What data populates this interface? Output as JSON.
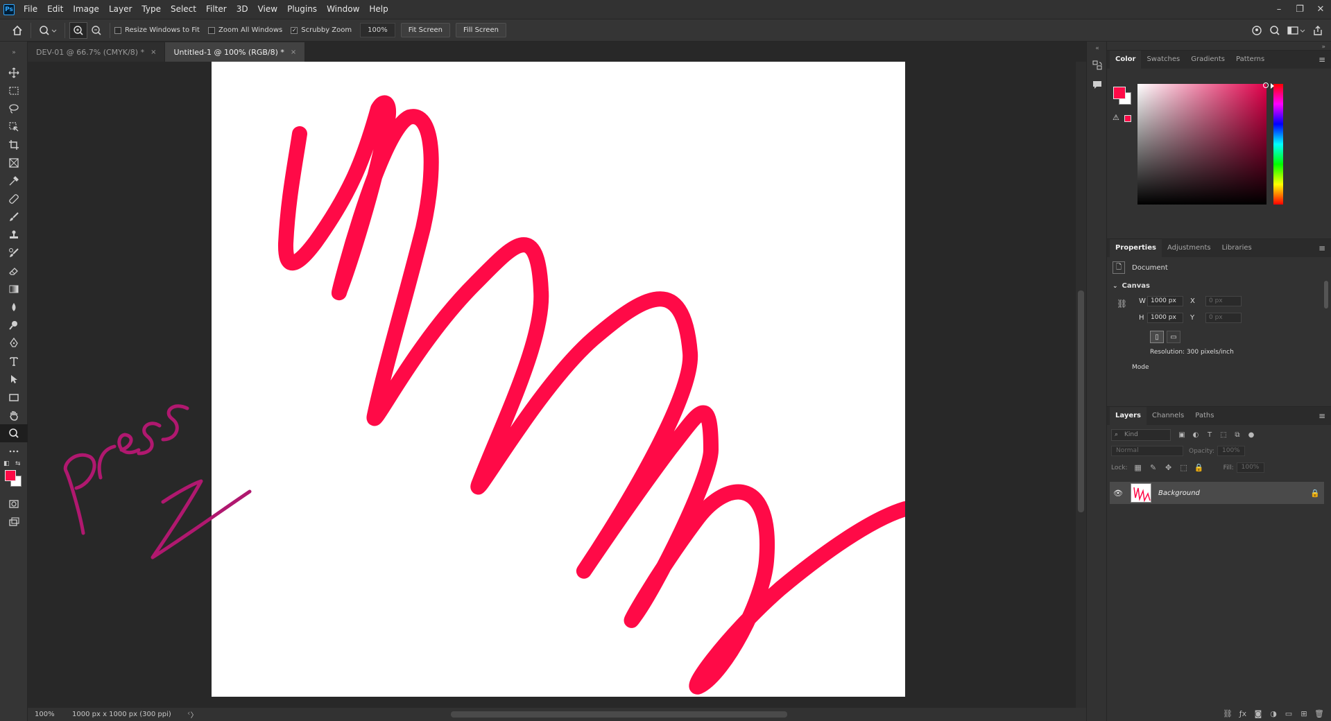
{
  "menu": [
    "File",
    "Edit",
    "Image",
    "Layer",
    "Type",
    "Select",
    "Filter",
    "3D",
    "View",
    "Plugins",
    "Window",
    "Help"
  ],
  "app_logo": "Ps",
  "window_controls": {
    "minimize": "–",
    "restore": "❐",
    "close": "✕"
  },
  "options": {
    "resize_windows": "Resize Windows to Fit",
    "zoom_all": "Zoom All Windows",
    "scrubby_zoom": "Scrubby Zoom",
    "scrubby_check": "✓",
    "zoom_value": "100%",
    "fit_screen": "Fit Screen",
    "fill_screen": "Fill Screen"
  },
  "tabs": [
    {
      "title": "DEV-01 @ 66.7% (CMYK/8) *",
      "close": "×"
    },
    {
      "title": "Untitled-1 @ 100% (RGB/8) *",
      "close": "×"
    }
  ],
  "status": {
    "zoom": "100%",
    "doc_info": "1000 px x 1000 px (300 ppi)",
    "arrow": "〉",
    "scroll_left": "‹",
    "scroll_right": "›"
  },
  "colors": {
    "foreground": "#ff0a47",
    "background": "#ffffff",
    "stroke": "#ff0a47",
    "annotation": "#b0186f"
  },
  "color_panel": {
    "tabs": [
      "Color",
      "Swatches",
      "Gradients",
      "Patterns"
    ],
    "warning": "⚠"
  },
  "properties": {
    "tabs": [
      "Properties",
      "Adjustments",
      "Libraries"
    ],
    "document_label": "Document",
    "canvas_label": "Canvas",
    "w_label": "W",
    "w_value": "1000 px",
    "h_label": "H",
    "h_value": "1000 px",
    "x_label": "X",
    "x_value": "0 px",
    "y_label": "Y",
    "y_value": "0 px",
    "resolution": "Resolution: 300 pixels/inch",
    "mode_label": "Mode"
  },
  "layers": {
    "tabs": [
      "Layers",
      "Channels",
      "Paths"
    ],
    "kind_placeholder": "Kind",
    "blend_mode": "Normal",
    "opacity_label": "Opacity:",
    "opacity_value": "100%",
    "lock_label": "Lock:",
    "fill_label": "Fill:",
    "fill_value": "100%",
    "items": [
      {
        "name": "Background"
      }
    ]
  },
  "panel_menu": "≡"
}
